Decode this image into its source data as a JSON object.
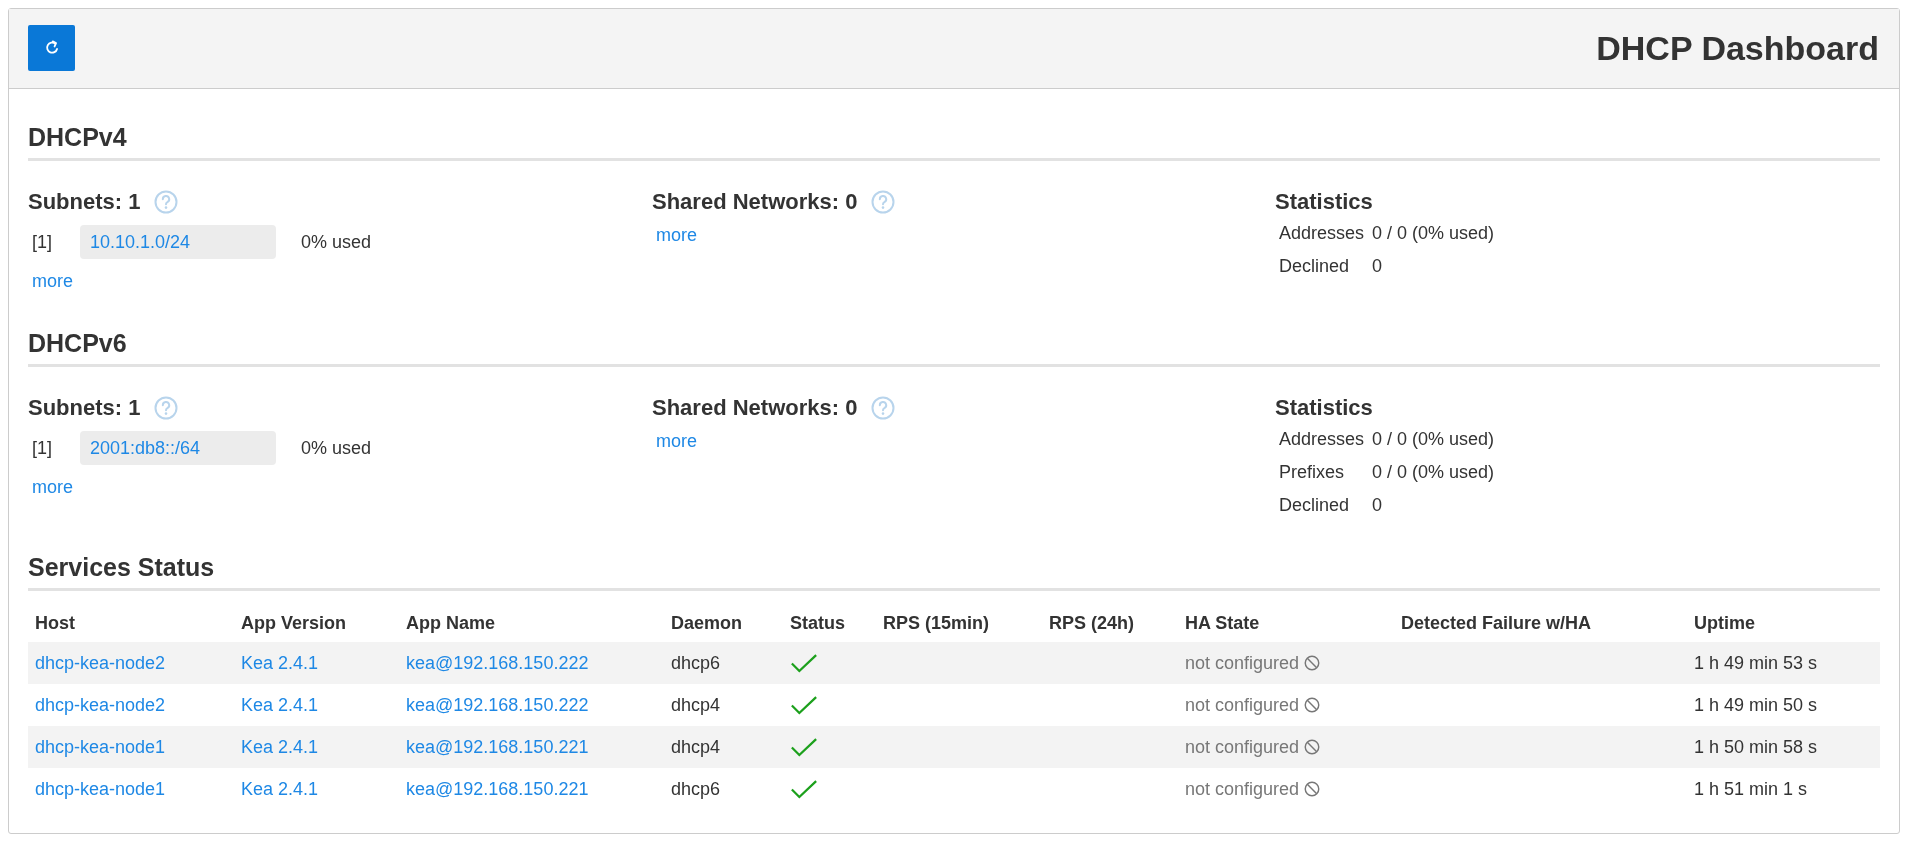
{
  "header": {
    "title": "DHCP Dashboard"
  },
  "sections": [
    {
      "title": "DHCPv4",
      "subnets": {
        "title": "Subnets: 1",
        "items": [
          {
            "index": "[1]",
            "subnet": "10.10.1.0/24",
            "usage": "0% used"
          }
        ],
        "more": "more"
      },
      "shared_networks": {
        "title": "Shared Networks: 0",
        "more": "more"
      },
      "statistics": {
        "title": "Statistics",
        "rows": [
          {
            "label": "Addresses",
            "value": "0 / 0 (0% used)"
          },
          {
            "label": "Declined",
            "value": "0"
          }
        ]
      }
    },
    {
      "title": "DHCPv6",
      "subnets": {
        "title": "Subnets: 1",
        "items": [
          {
            "index": "[1]",
            "subnet": "2001:db8::/64",
            "usage": "0% used"
          }
        ],
        "more": "more"
      },
      "shared_networks": {
        "title": "Shared Networks: 0",
        "more": "more"
      },
      "statistics": {
        "title": "Statistics",
        "rows": [
          {
            "label": "Addresses",
            "value": "0 / 0 (0% used)"
          },
          {
            "label": "Prefixes",
            "value": "0 / 0 (0% used)"
          },
          {
            "label": "Declined",
            "value": "0"
          }
        ]
      }
    }
  ],
  "services_status": {
    "title": "Services Status",
    "columns": [
      "Host",
      "App Version",
      "App Name",
      "Daemon",
      "Status",
      "RPS (15min)",
      "RPS (24h)",
      "HA State",
      "Detected Failure w/HA",
      "Uptime"
    ],
    "rows": [
      {
        "host": "dhcp-kea-node2",
        "app_version": "Kea 2.4.1",
        "app_name": "kea@192.168.150.222",
        "daemon": "dhcp6",
        "ok": true,
        "ha_state": "not configured",
        "uptime": "1 h 49 min 53 s"
      },
      {
        "host": "dhcp-kea-node2",
        "app_version": "Kea 2.4.1",
        "app_name": "kea@192.168.150.222",
        "daemon": "dhcp4",
        "ok": true,
        "ha_state": "not configured",
        "uptime": "1 h 49 min 50 s"
      },
      {
        "host": "dhcp-kea-node1",
        "app_version": "Kea 2.4.1",
        "app_name": "kea@192.168.150.221",
        "daemon": "dhcp4",
        "ok": true,
        "ha_state": "not configured",
        "uptime": "1 h 50 min 58 s"
      },
      {
        "host": "dhcp-kea-node1",
        "app_version": "Kea 2.4.1",
        "app_name": "kea@192.168.150.221",
        "daemon": "dhcp6",
        "ok": true,
        "ha_state": "not configured",
        "uptime": "1 h 51 min 1 s"
      }
    ]
  }
}
